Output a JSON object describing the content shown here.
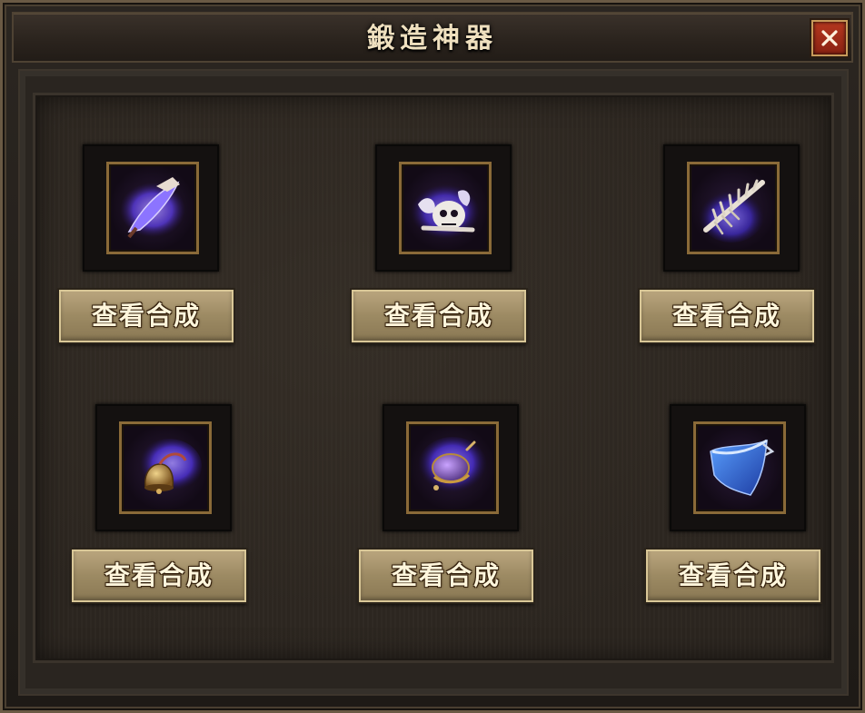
{
  "window": {
    "title": "鍛造神器",
    "close_label": "✕"
  },
  "items": [
    {
      "icon": "purple-blade-icon",
      "button_label": "查看合成"
    },
    {
      "icon": "skull-bones-icon",
      "button_label": "查看合成"
    },
    {
      "icon": "bone-spine-icon",
      "button_label": "查看合成"
    },
    {
      "icon": "bell-relic-icon",
      "button_label": "查看合成"
    },
    {
      "icon": "orb-relic-icon",
      "button_label": "查看合成"
    },
    {
      "icon": "blue-cloth-icon",
      "button_label": "查看合成"
    }
  ],
  "colors": {
    "title_text": "#efe0bf",
    "button_face": "#b9a57d",
    "close_red": "#b5381f",
    "slot_border_gold": "#8a6a38",
    "magic_purple": "#6a4bff"
  }
}
